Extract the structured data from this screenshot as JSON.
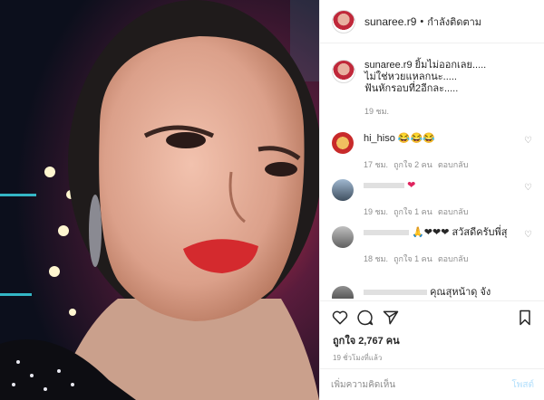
{
  "header": {
    "username": "sunaree.r9",
    "separator": "•",
    "follow_status": "กำลังติดตาม"
  },
  "caption": {
    "username": "sunaree.r9",
    "line1": "ยิ้มไม่ออกเลย.....",
    "line2": "ไม่ใช่หวยแหลกนะ.....",
    "line3": "ฟันหักรอบที่2อีกละ.....",
    "time": "19 ชม."
  },
  "comments": [
    {
      "username": "hi_hiso",
      "text": "😂😂😂",
      "time": "17 ชม.",
      "likes": "ถูกใจ 2 คน",
      "reply": "ตอบกลับ"
    },
    {
      "username": "",
      "text": "❤",
      "time": "19 ชม.",
      "likes": "ถูกใจ 1 คน",
      "reply": "ตอบกลับ"
    },
    {
      "username": "",
      "text": "🙏❤❤❤ สวัสดีครับพี่สุ",
      "time": "18 ชม.",
      "likes": "ถูกใจ 1 คน",
      "reply": "ตอบกลับ"
    },
    {
      "username": "",
      "text": "คุณสุหน้าดุ จัง",
      "time": "",
      "likes": "",
      "reply": ""
    }
  ],
  "actions": {
    "like_count": "ถูกใจ 2,767 คน",
    "posted_ago": "19 ชั่วโมงที่แล้ว"
  },
  "add_comment": {
    "placeholder": "เพิ่มความคิดเห็น",
    "post_label": "โพสต์"
  },
  "colors": {
    "lipstick": "#d42a2e",
    "link": "#b2dffc"
  }
}
